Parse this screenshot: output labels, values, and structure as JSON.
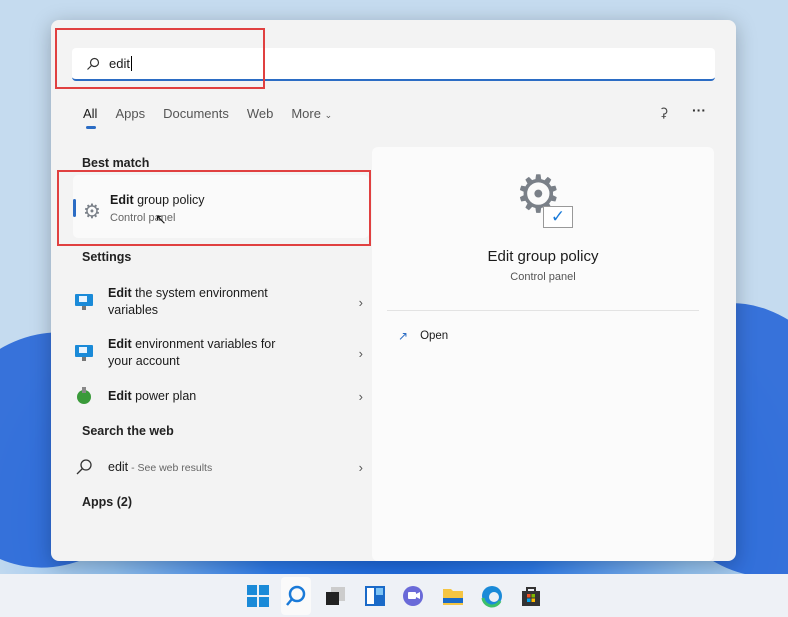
{
  "search": {
    "value": "edit"
  },
  "tabs": [
    {
      "label": "All"
    },
    {
      "label": "Apps"
    },
    {
      "label": "Documents"
    },
    {
      "label": "Web"
    },
    {
      "label": "More"
    }
  ],
  "best_match": {
    "heading": "Best match",
    "item": {
      "bold": "Edit",
      "rest": " group policy",
      "subtitle": "Control panel"
    }
  },
  "settings": {
    "heading": "Settings",
    "items": [
      {
        "bold": "Edit",
        "rest": " the system environment",
        "line2": "variables"
      },
      {
        "bold": "Edit",
        "rest": " environment variables for",
        "line2": "your account"
      },
      {
        "bold": "Edit",
        "rest": " power plan",
        "line2": ""
      }
    ]
  },
  "web": {
    "heading": "Search the web",
    "bold": "edit",
    "hint": " - See web results"
  },
  "apps": {
    "heading": "Apps (2)"
  },
  "detail": {
    "title": "Edit group policy",
    "subtitle": "Control panel",
    "action": "Open"
  },
  "colors": {
    "accent": "#2b6cc4",
    "highlight": "#e04040"
  }
}
